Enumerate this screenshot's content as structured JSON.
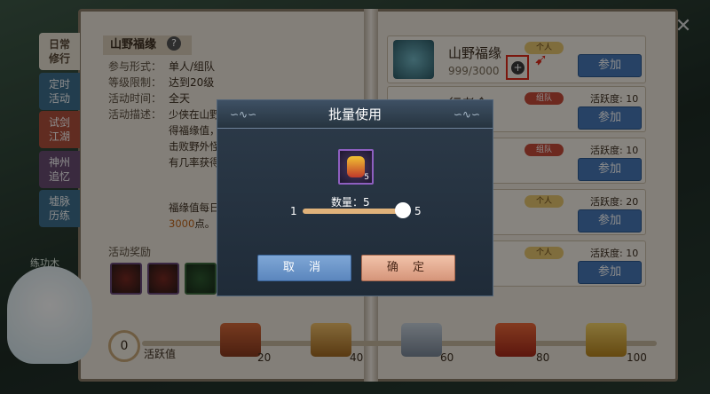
{
  "sidebar": {
    "tabs": [
      {
        "label": "日常\n修行"
      },
      {
        "label": "定时\n活动"
      },
      {
        "label": "试剑\n江湖"
      },
      {
        "label": "神州\n追忆"
      },
      {
        "label": "墟脉\n历练"
      }
    ]
  },
  "detail": {
    "title": "山野福缘",
    "rows": [
      {
        "label": "参与形式：",
        "value": "单人/组队"
      },
      {
        "label": "等级限制：",
        "value": "达到20级"
      },
      {
        "label": "活动时间：",
        "value": "全天"
      },
      {
        "label": "活动描述：",
        "value": ""
      }
    ],
    "description": "少侠在山野间游历，即可获得福缘值，拥有福缘值时可击败野外怪物获得装备，且有几率获得稀有值。",
    "description2_prefix": "福缘值每日恢复，上限为",
    "description2_highlight": "3000",
    "description2_suffix": "点。",
    "reward_label": "活动奖励"
  },
  "activities": [
    {
      "name": "山野福缘",
      "progress": "999/3000",
      "type": "个人",
      "activity": "",
      "join": "参加"
    },
    {
      "name": "行者令",
      "progress": "",
      "type": "组队",
      "activity": "活跃度: 10",
      "join": "参加"
    },
    {
      "name": "",
      "progress": "",
      "type": "组队",
      "activity": "活跃度: 10",
      "join": "参加"
    },
    {
      "name": "",
      "progress": "",
      "type": "个人",
      "activity": "活跃度: 20",
      "join": "参加"
    },
    {
      "name": "",
      "progress": "",
      "type": "个人",
      "activity": "活跃度: 10",
      "join": "参加"
    }
  ],
  "activity_bar": {
    "current": "0",
    "label": "活跃值",
    "milestones": [
      "20",
      "40",
      "60",
      "80",
      "100"
    ]
  },
  "mascot": {
    "label": "练功木"
  },
  "modal": {
    "title": "批量使用",
    "item_count": "5",
    "qty_label": "数量：5",
    "min": "1",
    "max": "5",
    "slider_value_fraction": 1.0,
    "cancel": "取 消",
    "confirm": "确 定"
  },
  "colors": {
    "join_button": "#4779b8",
    "highlight": "#c1661a",
    "annotation_red": "#e12a1a"
  }
}
